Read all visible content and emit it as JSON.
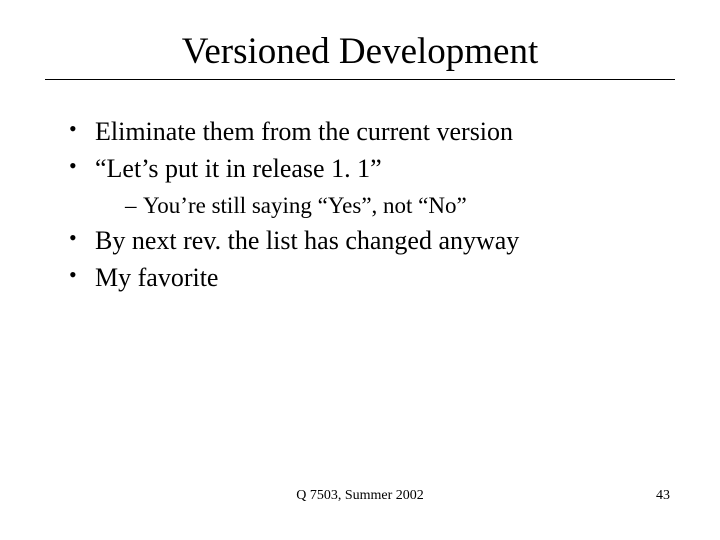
{
  "title": "Versioned Development",
  "bullets": {
    "b1": "Eliminate them from the current version",
    "b2": "“Let’s put it in release 1. 1”",
    "b2_sub1": "You’re still saying “Yes”, not “No”",
    "b3": "By next rev. the list has changed anyway",
    "b4": "My favorite"
  },
  "footer": {
    "center": "Q 7503, Summer 2002",
    "page": "43"
  }
}
